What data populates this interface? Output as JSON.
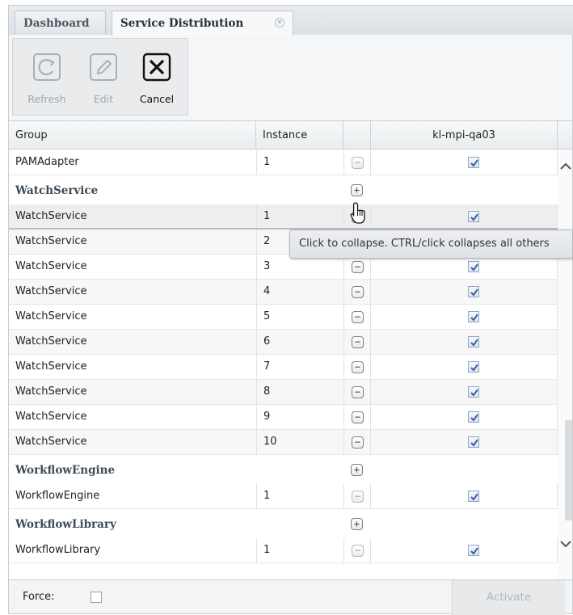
{
  "tabs": [
    {
      "label": "Dashboard",
      "active": false
    },
    {
      "label": "Service Distribution",
      "active": true
    }
  ],
  "toolbar": {
    "refresh_label": "Refresh",
    "edit_label": "Edit",
    "cancel_label": "Cancel",
    "refresh_enabled": false,
    "edit_enabled": false,
    "cancel_enabled": true
  },
  "grid": {
    "columns": {
      "group": "Group",
      "instance": "Instance",
      "toggle": "",
      "host": "kl-mpi-qa03"
    },
    "rows": [
      {
        "type": "item",
        "group": "PAMAdapter",
        "instance": "1",
        "checked": true
      },
      {
        "type": "group",
        "name": "WatchService",
        "toggle": "+"
      },
      {
        "type": "item",
        "group": "WatchService",
        "instance": "1",
        "checked": true
      },
      {
        "type": "item",
        "group": "WatchService",
        "instance": "2",
        "checked": true
      },
      {
        "type": "item",
        "group": "WatchService",
        "instance": "3",
        "checked": true
      },
      {
        "type": "item",
        "group": "WatchService",
        "instance": "4",
        "checked": true
      },
      {
        "type": "item",
        "group": "WatchService",
        "instance": "5",
        "checked": true
      },
      {
        "type": "item",
        "group": "WatchService",
        "instance": "6",
        "checked": true
      },
      {
        "type": "item",
        "group": "WatchService",
        "instance": "7",
        "checked": true
      },
      {
        "type": "item",
        "group": "WatchService",
        "instance": "8",
        "checked": true
      },
      {
        "type": "item",
        "group": "WatchService",
        "instance": "9",
        "checked": true
      },
      {
        "type": "item",
        "group": "WatchService",
        "instance": "10",
        "checked": true
      },
      {
        "type": "group",
        "name": "WorkflowEngine",
        "toggle": "+"
      },
      {
        "type": "item",
        "group": "WorkflowEngine",
        "instance": "1",
        "checked": true
      },
      {
        "type": "group",
        "name": "WorkflowLibrary",
        "toggle": "+"
      },
      {
        "type": "item",
        "group": "WorkflowLibrary",
        "instance": "1",
        "checked": true
      }
    ]
  },
  "tooltip": "Click to collapse. CTRL/click collapses all others",
  "footer": {
    "force_label": "Force:",
    "force_checked": false,
    "activate_label": "Activate"
  },
  "icons": {
    "minus": "−",
    "plus": "+"
  },
  "colors": {
    "header_text": "#3f4a54",
    "checkbox_check": "#3a5f9a",
    "disabled_text": "#a0a6ab"
  }
}
